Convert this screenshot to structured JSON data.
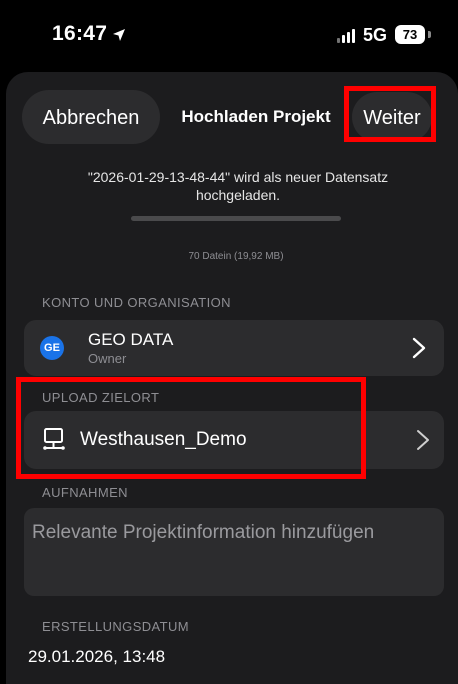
{
  "status_bar": {
    "time": "16:47",
    "network": "5G",
    "battery": "73"
  },
  "header": {
    "cancel_label": "Abbrechen",
    "title": "Hochladen Projekt",
    "next_label": "Weiter"
  },
  "upload": {
    "message": "\"2026-01-29-13-48-44\" wird als neuer Datensatz hochgeladen.",
    "progress_fraction": 0,
    "file_info": "70 Datein (19,92 MB)"
  },
  "account_section": {
    "header": "KONTO UND ORGANISATION",
    "avatar_initials": "GE",
    "name": "GEO DATA",
    "role": "Owner"
  },
  "destination_section": {
    "header": "UPLOAD ZIELORT",
    "name": "Westhausen_Demo"
  },
  "recordings_section": {
    "header": "AUFNAHMEN",
    "notes_placeholder": "Relevante Projektinformation hinzufügen"
  },
  "date_section": {
    "header": "ERSTELLUNGSDATUM",
    "value": "29.01.2026, 13:48"
  },
  "colors": {
    "background": "#000000",
    "sheet": "#1c1c1e",
    "row": "#2c2c2e",
    "secondary_text": "#8e8e93",
    "avatar": "#1a73e8",
    "highlight": "#ff0000"
  },
  "icons": {
    "location": "location-arrow-icon",
    "chevron": "chevron-right-icon",
    "destination": "computer-network-icon"
  }
}
